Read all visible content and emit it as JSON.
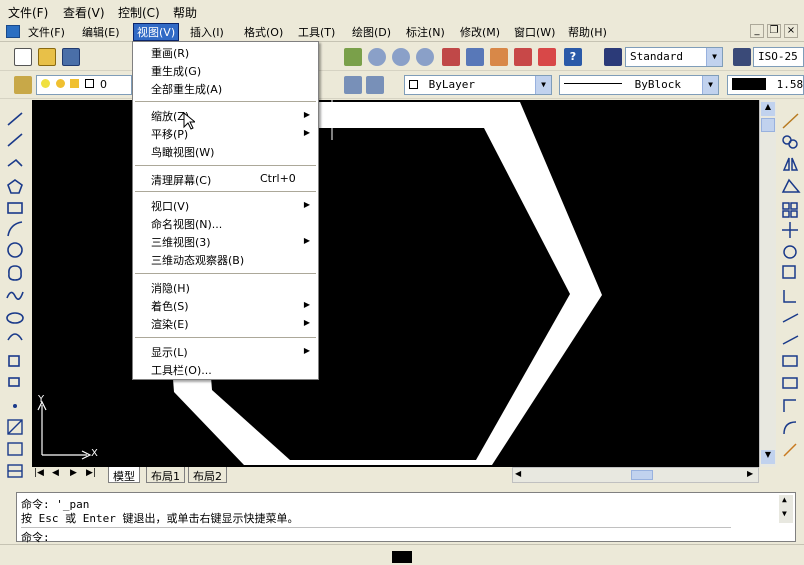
{
  "top_menu": [
    "文件(F)",
    "查看(V)",
    "控制(C)",
    "帮助"
  ],
  "doc_menu": [
    {
      "label": "文件(F)"
    },
    {
      "label": "编辑(E)"
    },
    {
      "label": "视图(V)"
    },
    {
      "label": "插入(I)"
    },
    {
      "label": "格式(O)"
    },
    {
      "label": "工具(T)"
    },
    {
      "label": "绘图(D)"
    },
    {
      "label": "标注(N)"
    },
    {
      "label": "修改(M)"
    },
    {
      "label": "窗口(W)"
    },
    {
      "label": "帮助(H)"
    }
  ],
  "window_buttons": [
    "_",
    "❐",
    "×"
  ],
  "toolbar": {
    "text_style": "Standard",
    "dim_style": "ISO-25",
    "layer_prefix": "0",
    "color": "ByLayer",
    "linetype": "ByBlock",
    "lineweight": "1.58"
  },
  "view_menu": [
    {
      "label": "重画(R)",
      "type": "item"
    },
    {
      "label": "重生成(G)",
      "type": "item"
    },
    {
      "label": "全部重生成(A)",
      "type": "item"
    },
    {
      "type": "sep"
    },
    {
      "label": "缩放(Z)",
      "type": "item",
      "submenu": true
    },
    {
      "label": "平移(P)",
      "type": "item",
      "submenu": true
    },
    {
      "label": "鸟瞰视图(W)",
      "type": "item"
    },
    {
      "type": "sep"
    },
    {
      "label": "清理屏幕(C)",
      "type": "item",
      "shortcut": "Ctrl+0"
    },
    {
      "type": "sep"
    },
    {
      "label": "视口(V)",
      "type": "item",
      "submenu": true
    },
    {
      "label": "命名视图(N)...",
      "type": "item"
    },
    {
      "label": "三维视图(3)",
      "type": "item",
      "submenu": true
    },
    {
      "label": "三维动态观察器(B)",
      "type": "item"
    },
    {
      "type": "sep"
    },
    {
      "label": "消隐(H)",
      "type": "item"
    },
    {
      "label": "着色(S)",
      "type": "item",
      "submenu": true
    },
    {
      "label": "渲染(E)",
      "type": "item",
      "submenu": true
    },
    {
      "type": "sep"
    },
    {
      "label": "显示(L)",
      "type": "item",
      "submenu": true
    },
    {
      "label": "工具栏(O)...",
      "type": "item"
    }
  ],
  "ucs": {
    "x": "X",
    "y": "Y"
  },
  "tabs": [
    "模型",
    "布局1",
    "布局2"
  ],
  "command": {
    "line1": "命令: '_pan",
    "line2": "按 Esc 或 Enter 键退出，或单击右键显示快捷菜单。",
    "line3": "命令:"
  },
  "colors": {
    "menu_highlight": "#316ac5",
    "canvas": "#000000",
    "shape_fill": "#ffffff"
  }
}
